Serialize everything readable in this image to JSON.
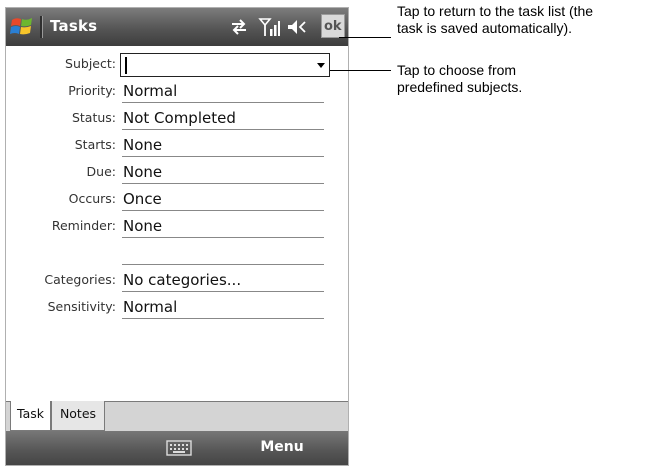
{
  "title_bar": {
    "app_title": "Tasks",
    "ok_label": "ok",
    "icons": [
      "windows-start-icon",
      "sync-icon",
      "signal-icon",
      "volume-icon"
    ]
  },
  "form": {
    "fields": [
      {
        "label": "Subject:",
        "value": ""
      },
      {
        "label": "Priority:",
        "value": "Normal"
      },
      {
        "label": "Status:",
        "value": "Not Completed"
      },
      {
        "label": "Starts:",
        "value": "None"
      },
      {
        "label": "Due:",
        "value": "None"
      },
      {
        "label": "Occurs:",
        "value": "Once"
      },
      {
        "label": "Reminder:",
        "value": "None"
      },
      {
        "label": "",
        "value": ""
      },
      {
        "label": "Categories:",
        "value": "No categories..."
      },
      {
        "label": "Sensitivity:",
        "value": "Normal"
      }
    ]
  },
  "tabs": [
    {
      "label": "Task",
      "active": true
    },
    {
      "label": "Notes",
      "active": false
    }
  ],
  "menu_bar": {
    "menu_label": "Menu",
    "keyboard_icon": "keyboard-icon"
  },
  "callouts": {
    "ok_line1": "Tap to return to the task list (the",
    "ok_line2": "task is saved automatically).",
    "subject_line1": "Tap to choose from",
    "subject_line2": "predefined subjects."
  },
  "colors": {
    "title_bar": "#555555",
    "menu_bar": "#555555",
    "tab_strip": "#d4d4d4"
  }
}
